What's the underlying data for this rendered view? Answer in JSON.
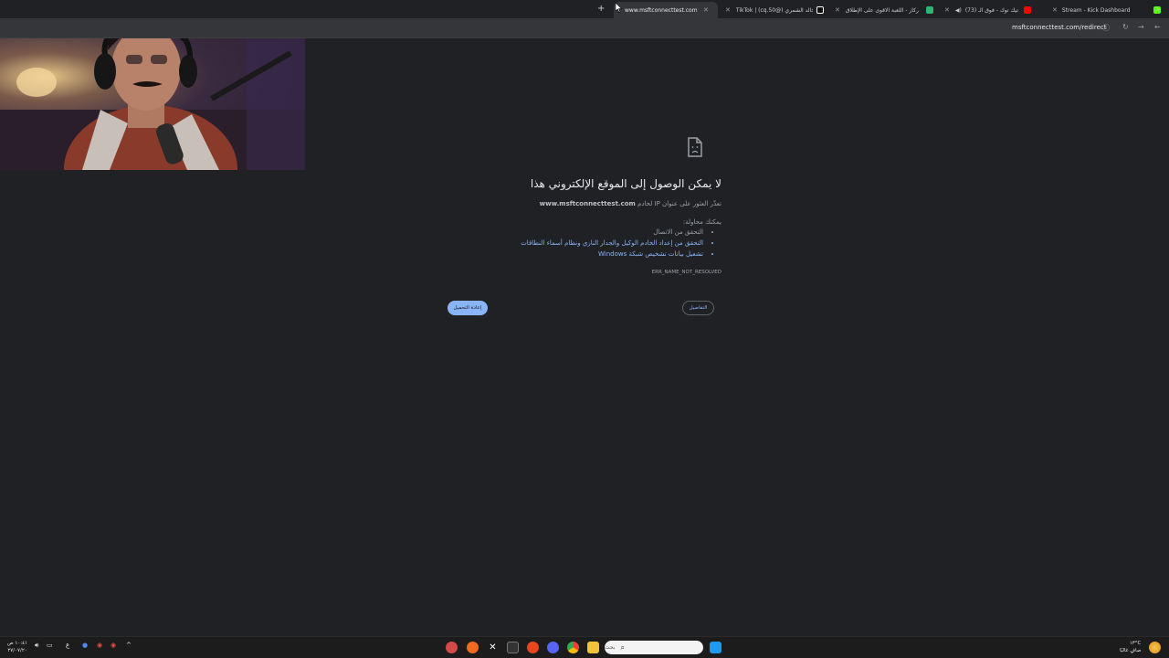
{
  "tabs": [
    {
      "title": "Stream - Kick Dashboard",
      "favicon_color": "#53fc18"
    },
    {
      "title": "(73) اغاني تيك توك - فوق الـ",
      "favicon_color": "#ff0000"
    },
    {
      "title": "ركاز - اللعبة الاقوى على الإطلاق",
      "favicon_color": "#2bb673"
    },
    {
      "title": "TikTok | (cq.50@) خالد الشمري",
      "favicon_color": "#ffffff"
    },
    {
      "title": "www.msftconnecttest.com",
      "active": true
    }
  ],
  "address_bar": {
    "url": "msftconnecttest.com/redirect"
  },
  "error_page": {
    "title": "لا يمكن الوصول إلى الموقع الإلكتروني هذا",
    "subtitle_prefix": "تعذّر العثور على عنوان IP لخادم",
    "subtitle_host": "www.msftconnecttest.com",
    "try_label": "يمكنك محاولة:",
    "suggestions": [
      {
        "text": "التحقق من الاتصال",
        "link": false
      },
      {
        "text": "التحقق من إعداد الخادم الوكيل والجدار الناري ونظام أسماء النطاقات",
        "link": true
      },
      {
        "text": "تشغيل بيانات تشخيص شبكة Windows",
        "link": true
      }
    ],
    "error_code": "ERR_NAME_NOT_RESOLVED",
    "details_button": "التفاصيل",
    "reload_button": "إعادة التحميل"
  },
  "taskbar": {
    "search_placeholder": "بحث",
    "clock_time": "١٠:٤١ ص",
    "clock_date": "٢٧/٠٧/٢٠",
    "weather_temp": "١٣°C",
    "weather_desc": "صافٍ غالبًا",
    "lang": "ع"
  },
  "colors": {
    "link": "#8ab4f8",
    "page_bg": "#202124",
    "toolbar_bg": "#35363a"
  }
}
